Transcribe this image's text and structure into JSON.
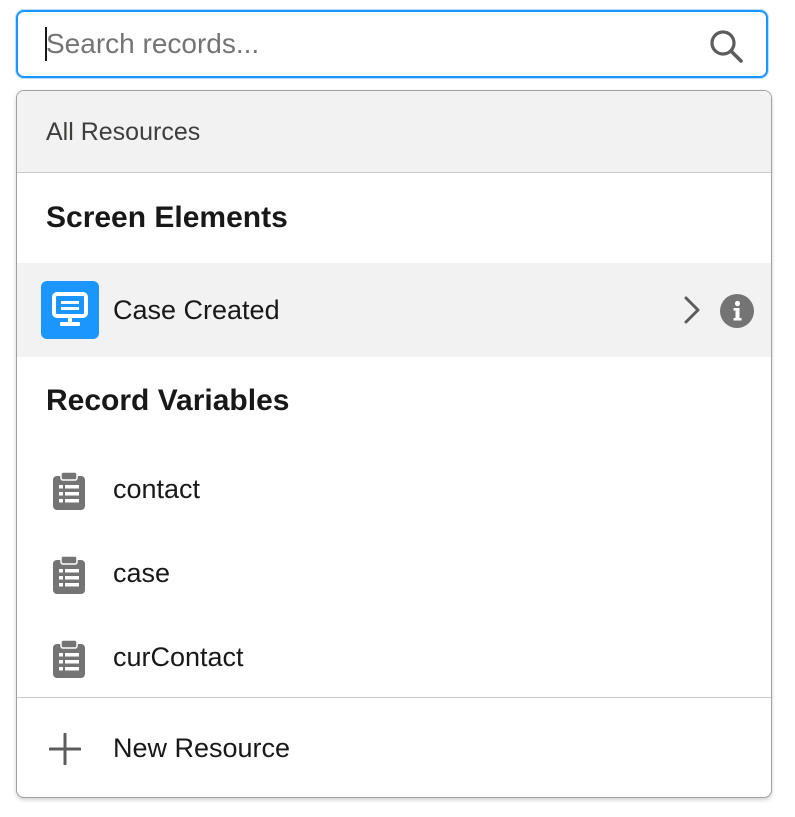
{
  "search": {
    "placeholder": "Search records...",
    "value": ""
  },
  "breadcrumb": {
    "label": "All Resources"
  },
  "sections": [
    {
      "heading": "Screen Elements",
      "items": [
        {
          "label": "Case Created",
          "icon": "screen-icon",
          "has_children": true,
          "has_info": true
        }
      ]
    },
    {
      "heading": "Record Variables",
      "items": [
        {
          "label": "contact",
          "icon": "record-variable-icon"
        },
        {
          "label": "case",
          "icon": "record-variable-icon"
        },
        {
          "label": "curContact",
          "icon": "record-variable-icon"
        }
      ]
    }
  ],
  "footer": {
    "new_resource_label": "New Resource"
  },
  "colors": {
    "accent": "#1b96ff",
    "highlight_bg": "#f3f2f2",
    "icon_gray": "#747474"
  }
}
